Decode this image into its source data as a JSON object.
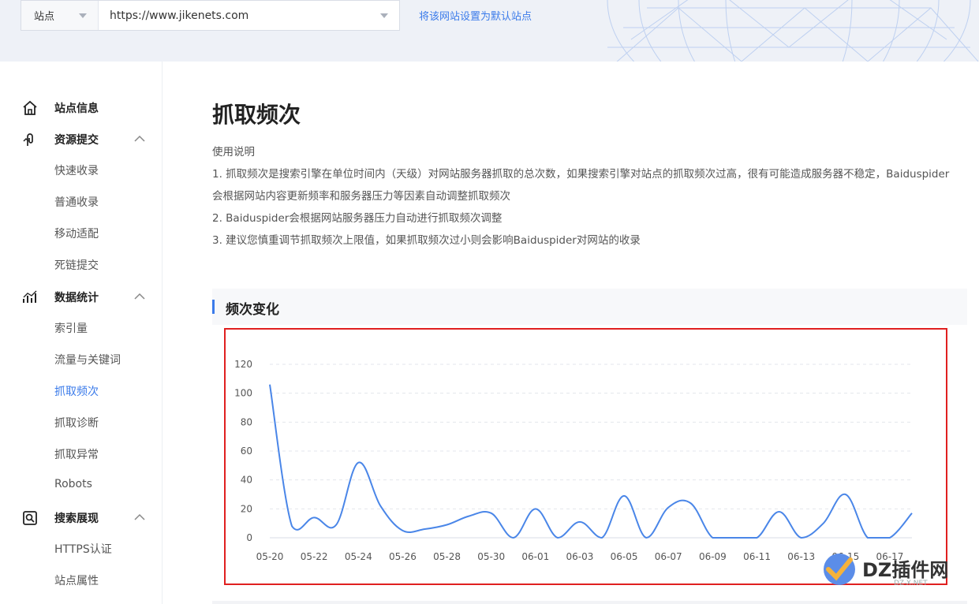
{
  "header": {
    "site_type": "站点",
    "site_url": "https://www.jikenets.com",
    "default_link": "将该网站设置为默认站点"
  },
  "sidebar": {
    "groups": [
      {
        "label": "站点信息",
        "icon": "home-icon"
      },
      {
        "label": "资源提交",
        "icon": "submit-icon",
        "items": [
          "快速收录",
          "普通收录",
          "移动适配",
          "死链提交"
        ]
      },
      {
        "label": "数据统计",
        "icon": "stats-icon",
        "items": [
          "索引量",
          "流量与关键词",
          "抓取频次",
          "抓取诊断",
          "抓取异常",
          "Robots"
        ]
      },
      {
        "label": "搜索展现",
        "icon": "search-display-icon",
        "items": [
          "HTTPS认证",
          "站点属性"
        ]
      }
    ],
    "active_item": "抓取频次"
  },
  "main": {
    "title": "抓取频次",
    "usage_title": "使用说明",
    "usage_lines": [
      "1. 抓取频次是搜索引擎在单位时间内（天级）对网站服务器抓取的总次数，如果搜索引擎对站点的抓取频次过高，很有可能造成服务器不稳定，Baiduspider",
      "会根据网站内容更新频率和服务器压力等因素自动调整抓取频次",
      "2. Baiduspider会根据网站服务器压力自动进行抓取频次调整",
      "3. 建议您慎重调节抓取频次上限值，如果抓取频次过小则会影响Baiduspider对网站的收录"
    ],
    "section_title": "频次变化"
  },
  "chart_data": {
    "type": "line",
    "x": [
      "05-20",
      "05-21",
      "05-22",
      "05-23",
      "05-24",
      "05-25",
      "05-26",
      "05-27",
      "05-28",
      "05-29",
      "05-30",
      "05-31",
      "06-01",
      "06-02",
      "06-03",
      "06-04",
      "06-05",
      "06-06",
      "06-07",
      "06-08",
      "06-09",
      "06-10",
      "06-11",
      "06-12",
      "06-13",
      "06-14",
      "06-15",
      "06-16",
      "06-17",
      "06-18"
    ],
    "x_tick_labels": [
      "05-20",
      "05-22",
      "05-24",
      "05-26",
      "05-28",
      "05-30",
      "06-01",
      "06-03",
      "06-05",
      "06-07",
      "06-09",
      "06-11",
      "06-13",
      "06-15",
      "06-17"
    ],
    "series": [
      {
        "values": [
          106,
          8,
          14,
          9,
          52,
          22,
          5,
          6,
          9,
          15,
          17,
          0,
          20,
          0,
          11,
          0,
          29,
          0,
          21,
          24,
          0,
          0,
          0,
          18,
          0,
          10,
          30,
          0,
          0,
          17
        ]
      }
    ],
    "ylim": [
      0,
      120
    ],
    "y_ticks": [
      0,
      20,
      40,
      60,
      80,
      100,
      120
    ],
    "grid": "horizontal-dashed",
    "line_color": "#4a86e8"
  },
  "watermark": {
    "text": "DZ插件网",
    "sub": "DZ-X.NET"
  }
}
